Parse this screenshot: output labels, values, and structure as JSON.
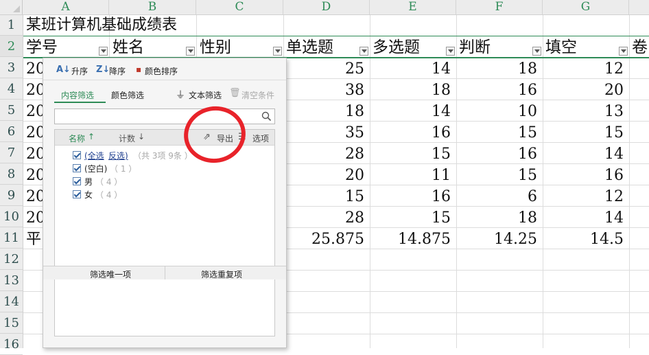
{
  "sheet": {
    "columns": [
      "A",
      "B",
      "C",
      "D",
      "E",
      "F",
      "G"
    ],
    "rows": [
      "1",
      "2",
      "3",
      "4",
      "5",
      "6",
      "7",
      "8",
      "9",
      "10",
      "11",
      "12",
      "13",
      "14",
      "15",
      "16"
    ],
    "title": "某班计算机基础成绩表",
    "headers": [
      "学号",
      "姓名",
      "性别",
      "单选题",
      "多选题",
      "判断",
      "填空",
      "卷"
    ],
    "col_a_values": [
      "20",
      "20",
      "20",
      "20",
      "20",
      "20",
      "20",
      "20",
      "平"
    ],
    "data_rows": [
      [
        "25",
        "14",
        "18",
        "12"
      ],
      [
        "38",
        "18",
        "16",
        "20"
      ],
      [
        "18",
        "14",
        "10",
        "13"
      ],
      [
        "35",
        "16",
        "15",
        "15"
      ],
      [
        "28",
        "15",
        "16",
        "14"
      ],
      [
        "20",
        "11",
        "15",
        "16"
      ],
      [
        "15",
        "16",
        "6",
        "12"
      ],
      [
        "28",
        "15",
        "18",
        "14"
      ],
      [
        "25.875",
        "14.875",
        "14.25",
        "14.5"
      ]
    ],
    "accent_color": "#2e8b57"
  },
  "filter_panel": {
    "sort_asc": "升序",
    "sort_desc": "降序",
    "sort_color": "颜色排序",
    "tab_content": "内容筛选",
    "tab_color": "颜色筛选",
    "text_filter": "文本筛选",
    "clear_conditions": "清空条件",
    "search_placeholder": "",
    "list_col_name": "名称",
    "list_col_count": "计数",
    "export": "导出",
    "options": "选项",
    "items": [
      {
        "label_a": "(全选",
        "label_b": "反选)",
        "note": "（共 3项 9条 ）",
        "checked": true
      },
      {
        "label": "(空白)",
        "note": "（ 1 ）",
        "checked": true
      },
      {
        "label": "男",
        "note": "（ 4 ）",
        "checked": true
      },
      {
        "label": "女",
        "note": "（ 4 ）",
        "checked": true
      }
    ],
    "btn_unique": "筛选唯一项",
    "btn_duplicate": "筛选重复项",
    "annotation_color": "#e8232a"
  }
}
